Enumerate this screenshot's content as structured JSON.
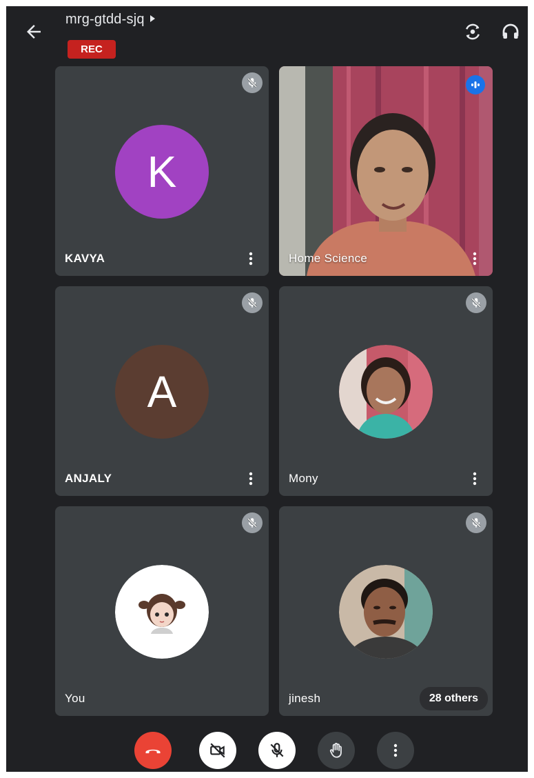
{
  "header": {
    "meeting_code": "mrg-gtdd-sjq",
    "rec_badge": "REC"
  },
  "participants": [
    {
      "name": "KAVYA",
      "avatar_letter": "K",
      "avatar_color": "#a142c2",
      "muted": true
    },
    {
      "name": "Home Science",
      "video_on": true,
      "speaking": true
    },
    {
      "name": "ANJALY",
      "avatar_letter": "A",
      "avatar_color": "#5b3d31",
      "muted": true
    },
    {
      "name": "Mony",
      "photo_avatar": true,
      "muted": true
    },
    {
      "name": "You",
      "photo_avatar": true,
      "muted": true
    },
    {
      "name": "jinesh",
      "photo_avatar": true,
      "muted": true
    }
  ],
  "others_chip": "28 others",
  "colors": {
    "background": "#202124",
    "tile": "#3c4043",
    "rec": "#c5221f",
    "end_call": "#ea4335",
    "speaking": "#1a73e8"
  },
  "icons": {
    "back": "arrow-left-icon",
    "switch_camera": "switch-camera-icon",
    "audio_output": "headphones-icon",
    "mic_off": "mic-off-icon",
    "more": "more-vert-icon",
    "end_call": "call-end-icon",
    "camera_off": "videocam-off-icon",
    "raise_hand": "hand-icon"
  }
}
